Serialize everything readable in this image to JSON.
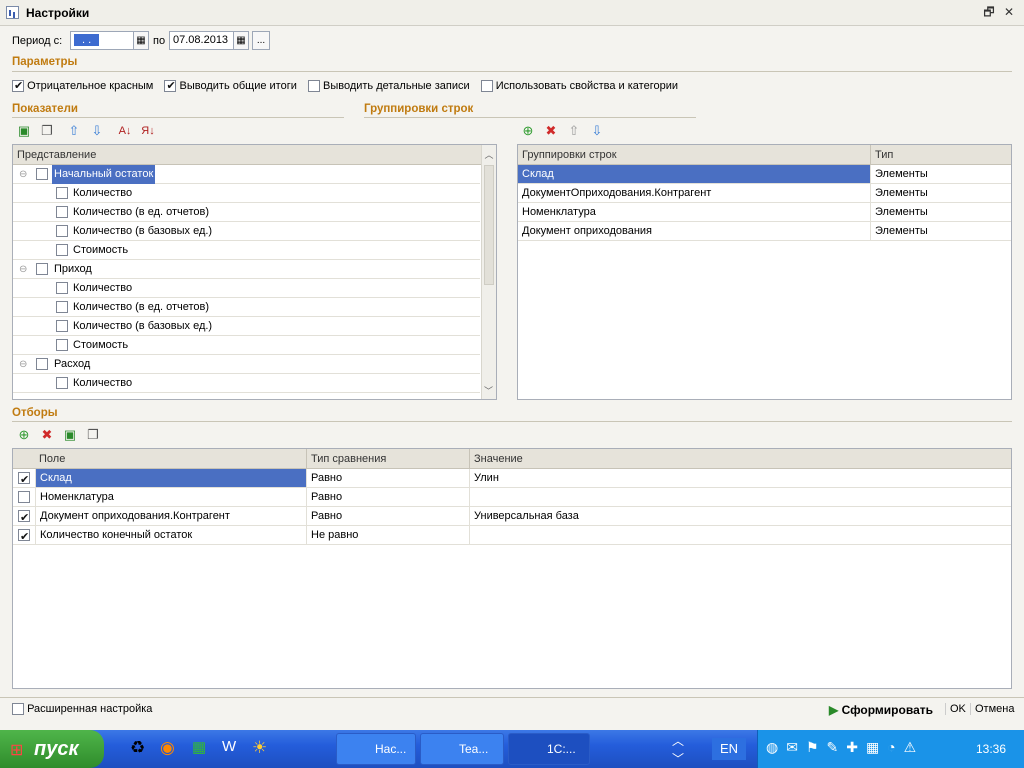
{
  "window": {
    "title": "Настройки"
  },
  "period": {
    "from_label": "Период с:",
    "from_value": ". .",
    "to_label": "по",
    "to_value": "07.08.2013",
    "more": "..."
  },
  "params": {
    "title": "Параметры",
    "opts": [
      {
        "label": "Отрицательное красным",
        "checked": true
      },
      {
        "label": "Выводить общие итоги",
        "checked": true
      },
      {
        "label": "Выводить детальные записи",
        "checked": false
      },
      {
        "label": "Использовать свойства и категории",
        "checked": false
      }
    ]
  },
  "indicators": {
    "title": "Показатели",
    "header": "Представление",
    "rows": [
      {
        "label": "Начальный остаток",
        "level": 0
      },
      {
        "label": "Количество",
        "level": 1
      },
      {
        "label": "Количество (в ед. отчетов)",
        "level": 1
      },
      {
        "label": "Количество (в базовых ед.)",
        "level": 1
      },
      {
        "label": "Стоимость",
        "level": 1
      },
      {
        "label": "Приход",
        "level": 0
      },
      {
        "label": "Количество",
        "level": 1
      },
      {
        "label": "Количество (в ед. отчетов)",
        "level": 1
      },
      {
        "label": "Количество (в базовых ед.)",
        "level": 1
      },
      {
        "label": "Стоимость",
        "level": 1
      },
      {
        "label": "Расход",
        "level": 0
      },
      {
        "label": "Количество",
        "level": 1
      }
    ]
  },
  "groupings": {
    "title": "Группировки строк",
    "col1": "Группировки строк",
    "col2": "Тип",
    "rows": [
      {
        "name": "Склад",
        "type": "Элементы"
      },
      {
        "name": "ДокументОприходования.Контрагент",
        "type": "Элементы"
      },
      {
        "name": "Номенклатура",
        "type": "Элементы"
      },
      {
        "name": "Документ оприходования",
        "type": "Элементы"
      }
    ]
  },
  "filters": {
    "title": "Отборы",
    "col_field": "Поле",
    "col_cmp": "Тип сравнения",
    "col_val": "Значение",
    "rows": [
      {
        "checked": true,
        "field": "Склад",
        "cmp": "Равно",
        "val": "Улин"
      },
      {
        "checked": false,
        "field": "Номенклатура",
        "cmp": "Равно",
        "val": ""
      },
      {
        "checked": true,
        "field": "Документ оприходования.Контрагент",
        "cmp": "Равно",
        "val": "Универсальная база"
      },
      {
        "checked": true,
        "field": "Количество конечный остаток",
        "cmp": "Не равно",
        "val": ""
      }
    ]
  },
  "footer": {
    "advanced": "Расширенная настройка",
    "generate": "Сформировать",
    "ok": "OK",
    "cancel": "Отмена"
  },
  "taskbar": {
    "start": "пуск",
    "tasks": [
      "Нас...",
      "Tea...",
      "1С:..."
    ],
    "lang": "EN",
    "clock": "13:36"
  }
}
